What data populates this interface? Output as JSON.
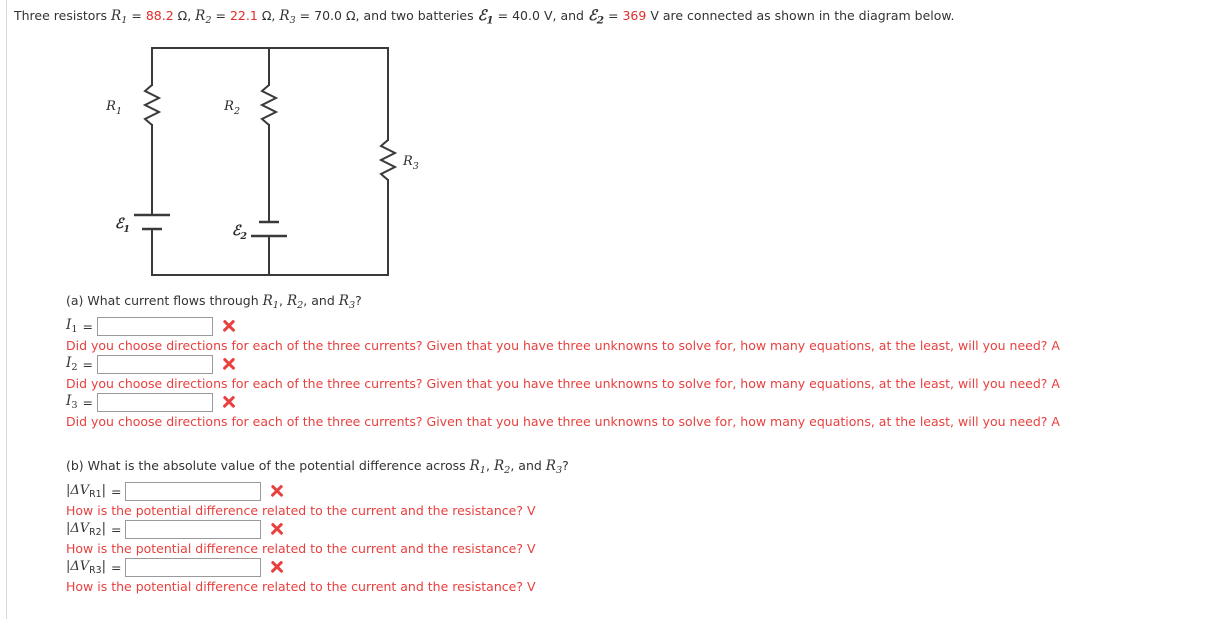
{
  "statement": {
    "lead": "Three resistors",
    "r1_sym": "R",
    "r1_sub": "1",
    "r1_eq": "=",
    "r1_val": "88.2",
    "r1_unit": "Ω,",
    "r2_sym": "R",
    "r2_sub": "2",
    "r2_eq": "=",
    "r2_val": "22.1",
    "r2_unit": "Ω,",
    "r3_sym": "R",
    "r3_sub": "3",
    "r3_eq": "=",
    "r3_val": "70.0",
    "r3_unit": "Ω,",
    "mid": "and two batteries",
    "e1_sym": "ℰ",
    "e1_sub": "1",
    "e1_eq": "=",
    "e1_val": "40.0",
    "e1_unit": "V,",
    "and": "and",
    "e2_sym": "ℰ",
    "e2_sub": "2",
    "e2_eq": "=",
    "e2_val": "369",
    "e2_unit": "V",
    "tail": "are connected as shown in the diagram below."
  },
  "colors": {
    "red": "#e32b2b",
    "feedback_red": "#e8403f",
    "text": "#333333",
    "wire": "#3a3a3a",
    "input_border": "#9a9a9a"
  },
  "circuit": {
    "labels": {
      "r1": "R",
      "r1_sub": "1",
      "r2": "R",
      "r2_sub": "2",
      "r3": "R",
      "r3_sub": "3",
      "e1": "ℰ",
      "e1_sub": "1",
      "e2": "ℰ",
      "e2_sub": "2"
    },
    "description": "Rectangular loop with three vertical branches: left branch has R1 and battery E1, middle branch has R2 and battery E2, right branch has R3."
  },
  "part_a": {
    "prompt_pre": "(a) What current flows through",
    "prompt_r1": "R",
    "prompt_r1_sub": "1",
    "prompt_r2": "R",
    "prompt_r2_sub": "2",
    "prompt_r3": "R",
    "prompt_r3_sub": "3",
    "prompt_and": "and",
    "prompt_end": "?",
    "rows": [
      {
        "symbol": "I",
        "sub": "1",
        "eq": "=",
        "value": "",
        "placeholder": "",
        "status": "incorrect",
        "feedback": "Did you choose directions for each of the three currents? Given that you have three unknowns to solve for, how many equations, at the least, will you need? A"
      },
      {
        "symbol": "I",
        "sub": "2",
        "eq": "=",
        "value": "",
        "placeholder": "",
        "status": "incorrect",
        "feedback": "Did you choose directions for each of the three currents? Given that you have three unknowns to solve for, how many equations, at the least, will you need? A"
      },
      {
        "symbol": "I",
        "sub": "3",
        "eq": "=",
        "value": "",
        "placeholder": "",
        "status": "incorrect",
        "feedback": "Did you choose directions for each of the three currents? Given that you have three unknowns to solve for, how many equations, at the least, will you need? A"
      }
    ]
  },
  "part_b": {
    "prompt_pre": "(b) What is the absolute value of the potential difference across",
    "prompt_r1": "R",
    "prompt_r1_sub": "1",
    "prompt_r2": "R",
    "prompt_r2_sub": "2",
    "prompt_r3": "R",
    "prompt_r3_sub": "3",
    "prompt_and": "and",
    "prompt_end": "?",
    "rows": [
      {
        "symbol": "|ΔV",
        "sub": "R1",
        "close": "|",
        "eq": "=",
        "value": "",
        "placeholder": "",
        "status": "incorrect",
        "feedback": "How is the potential difference related to the current and the resistance? V"
      },
      {
        "symbol": "|ΔV",
        "sub": "R2",
        "close": "|",
        "eq": "=",
        "value": "",
        "placeholder": "",
        "status": "incorrect",
        "feedback": "How is the potential difference related to the current and the resistance? V"
      },
      {
        "symbol": "|ΔV",
        "sub": "R3",
        "close": "|",
        "eq": "=",
        "value": "",
        "placeholder": "",
        "status": "incorrect",
        "feedback": "How is the potential difference related to the current and the resistance? V"
      }
    ]
  }
}
